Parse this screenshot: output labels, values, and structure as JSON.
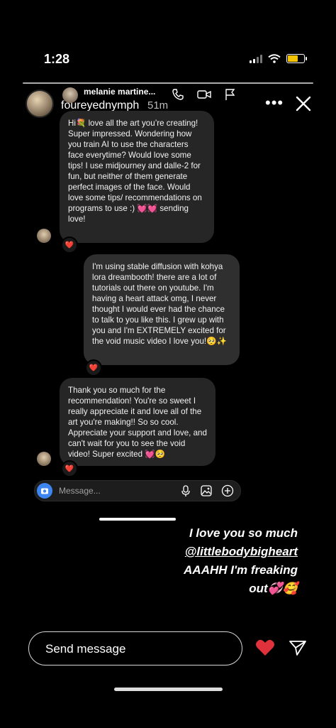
{
  "status_bar": {
    "time": "1:28"
  },
  "story": {
    "username": "foureyednymph",
    "time_ago": "51m"
  },
  "dm_header": {
    "name": "melanie martine..."
  },
  "messages": [
    {
      "from": "them",
      "text": "Hi💐 love all the art you’re creating! Super impressed. Wondering how you train AI to use the characters face everytime? Would love some tips! I use midjourney and dalle-2 for fun, but neither of them generate perfect images of the face. Would love some tips/ recommendations on programs to use :) 💓💓 sending love!",
      "reaction": "❤️"
    },
    {
      "from": "me",
      "text": "I'm using stable diffusion with kohya lora dreambooth! there are a lot of tutorials out there on youtube. I'm having a heart attack omg, I never thought I would ever had the chance to talk to you like this. I grew up with you and I'm EXTREMELY excited for the void music video I love you!🥺✨",
      "reaction": "❤️"
    },
    {
      "from": "them",
      "text": "Thank you so much for the recommendation! You're so sweet I really appreciate it and love all of the art you're making!! So so cool. Appreciate your support and love, and can't wait for you to see the void video! Super excited 💓🥺",
      "reaction": "❤️"
    }
  ],
  "composer": {
    "placeholder": "Message..."
  },
  "caption": {
    "line1": "I love you so much",
    "line2": "@littlebodybigheart",
    "line3": "AAAHH I'm freaking",
    "line4": "out💞🥰"
  },
  "footer": {
    "send_placeholder": "Send message"
  },
  "colors": {
    "bubble": "#262626",
    "heart": "#e0323c",
    "camera": "#3d86f0"
  },
  "icons": [
    "phone-icon",
    "video-icon",
    "flag-icon",
    "more-icon",
    "close-icon",
    "camera-icon",
    "mic-icon",
    "image-icon",
    "plus-icon",
    "heart-icon",
    "send-icon"
  ]
}
